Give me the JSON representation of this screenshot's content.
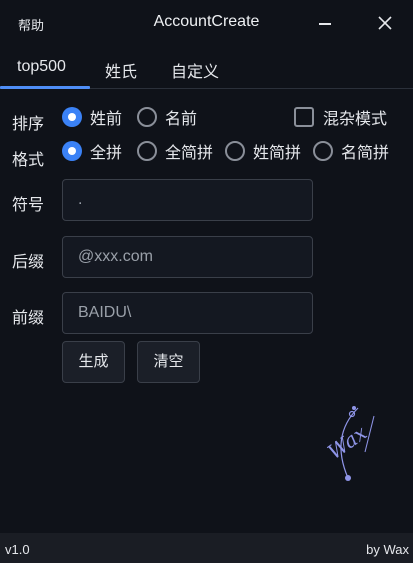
{
  "window": {
    "help": "帮助",
    "title": "AccountCreate",
    "minimize_icon": "minimize-icon",
    "close_icon": "close-icon"
  },
  "tabs": [
    {
      "label": "top500",
      "active": true
    },
    {
      "label": "姓氏",
      "active": false
    },
    {
      "label": "自定义",
      "active": false
    }
  ],
  "order": {
    "label": "排序",
    "options": [
      {
        "label": "姓前",
        "checked": true
      },
      {
        "label": "名前",
        "checked": false
      }
    ],
    "mixed_mode": {
      "label": "混杂模式",
      "checked": false
    }
  },
  "format": {
    "label": "格式",
    "options": [
      {
        "label": "全拼",
        "checked": true
      },
      {
        "label": "全简拼",
        "checked": false
      },
      {
        "label": "姓简拼",
        "checked": false
      },
      {
        "label": "名简拼",
        "checked": false
      }
    ]
  },
  "fields": {
    "symbol": {
      "label": "符号",
      "value": "."
    },
    "suffix": {
      "label": "后缀",
      "value": "@xxx.com"
    },
    "prefix": {
      "label": "前缀",
      "value": "BAIDU\\"
    }
  },
  "buttons": {
    "generate": "生成",
    "clear": "清空"
  },
  "logo": {
    "text": "Wax",
    "color": "#8f95e8"
  },
  "status": {
    "version": "v1.0",
    "author": "by Wax"
  },
  "colors": {
    "background": "#0f1219",
    "accent": "#3b82f6",
    "statusbar": "#1a1d24"
  }
}
